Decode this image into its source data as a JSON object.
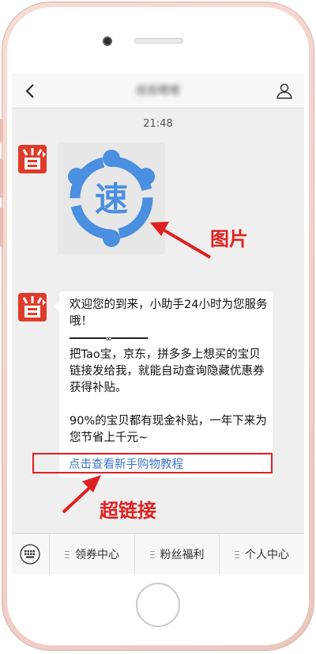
{
  "chat": {
    "title": "叔叔嗯嗯",
    "time": "21:48",
    "message": {
      "greeting": "欢迎您的到来，小助手24小时为您服务哦！",
      "divider": "━━━━━━━━∞━━━━━━━━",
      "body_line1": "把Tao宝，京东，拼多多上想买的宝贝链接发给我，就能自动查询隐藏优惠券获得补贴。",
      "body_line2": "90%的宝贝都有现金补贴，一年下来为您节省上千元~",
      "link": "点击查看新手购物教程"
    },
    "image_glyph": "速"
  },
  "bottom_menu": {
    "items": [
      {
        "label": "领券中心"
      },
      {
        "label": "粉丝福利"
      },
      {
        "label": "个人中心"
      }
    ]
  },
  "annotations": {
    "image_label": "图片",
    "link_label": "超链接"
  },
  "icons": {
    "back": "chevron-left-icon",
    "profile": "person-icon",
    "keyboard": "keyboard-icon",
    "avatar": "sheng-logo"
  },
  "colors": {
    "accent_red": "#e02020",
    "link_blue": "#3b74c7",
    "logo_blue": "#4a8fe0",
    "avatar_red": "#e03b2a"
  }
}
